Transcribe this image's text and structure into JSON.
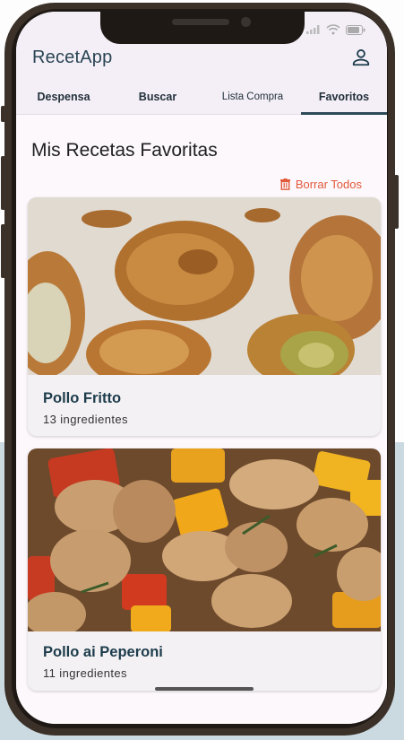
{
  "app": {
    "title": "RecetApp"
  },
  "tabs": [
    {
      "label": "Despensa"
    },
    {
      "label": "Buscar"
    },
    {
      "label": "Lista Compra"
    },
    {
      "label": "Favoritos",
      "active": true
    }
  ],
  "page": {
    "title": "Mis Recetas Favoritas",
    "clear_all_label": "Borrar Todos"
  },
  "recipes": [
    {
      "name": "Pollo Fritto",
      "ingredients": "13 ingredientes"
    },
    {
      "name": "Pollo ai Peperoni",
      "ingredients": "11 ingredientes"
    }
  ],
  "colors": {
    "accent": "#e2593a",
    "primary": "#2c4a57",
    "appbar": "#f4eff7"
  },
  "icons": {
    "account": "account-icon",
    "delete": "trash-icon",
    "signal": "signal-icon",
    "wifi": "wifi-icon",
    "battery": "battery-icon"
  }
}
